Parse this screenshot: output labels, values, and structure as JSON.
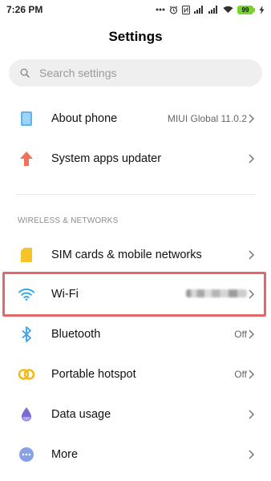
{
  "status_bar": {
    "time": "7:26 PM",
    "battery": "99",
    "icons": [
      "dots-icon",
      "alarm-icon",
      "nfc-icon",
      "signal-icon",
      "signal-icon",
      "wifi-icon",
      "battery-icon",
      "charging-icon"
    ]
  },
  "header": {
    "title": "Settings"
  },
  "search": {
    "placeholder": "Search settings"
  },
  "items": [
    {
      "label": "About phone",
      "value": "MIUI Global 11.0.2",
      "icon": "phone-icon"
    },
    {
      "label": "System apps updater",
      "value": "",
      "icon": "arrow-up-icon"
    },
    {
      "label": "SIM cards & mobile networks",
      "value": "",
      "icon": "sim-icon"
    },
    {
      "label": "Wi-Fi",
      "value": "",
      "icon": "wifi-icon"
    },
    {
      "label": "Bluetooth",
      "value": "Off",
      "icon": "bluetooth-icon"
    },
    {
      "label": "Portable hotspot",
      "value": "Off",
      "icon": "hotspot-icon"
    },
    {
      "label": "Data usage",
      "value": "",
      "icon": "data-usage-icon"
    },
    {
      "label": "More",
      "value": "",
      "icon": "more-icon"
    }
  ],
  "section": {
    "wireless": "WIRELESS & NETWORKS"
  },
  "colors": {
    "highlight": "#e06a6a",
    "phone_icon": "#5fb3f0",
    "updater_icon": "#f2705a",
    "sim_icon": "#f6c428",
    "wifi_icon": "#38a9e6",
    "bluetooth_icon": "#3aa0e8",
    "hotspot_icon": "#f4b918",
    "data_usage_icon": "#7a6ad8",
    "more_icon": "#8aa0e6",
    "battery": "#7ad22f"
  }
}
